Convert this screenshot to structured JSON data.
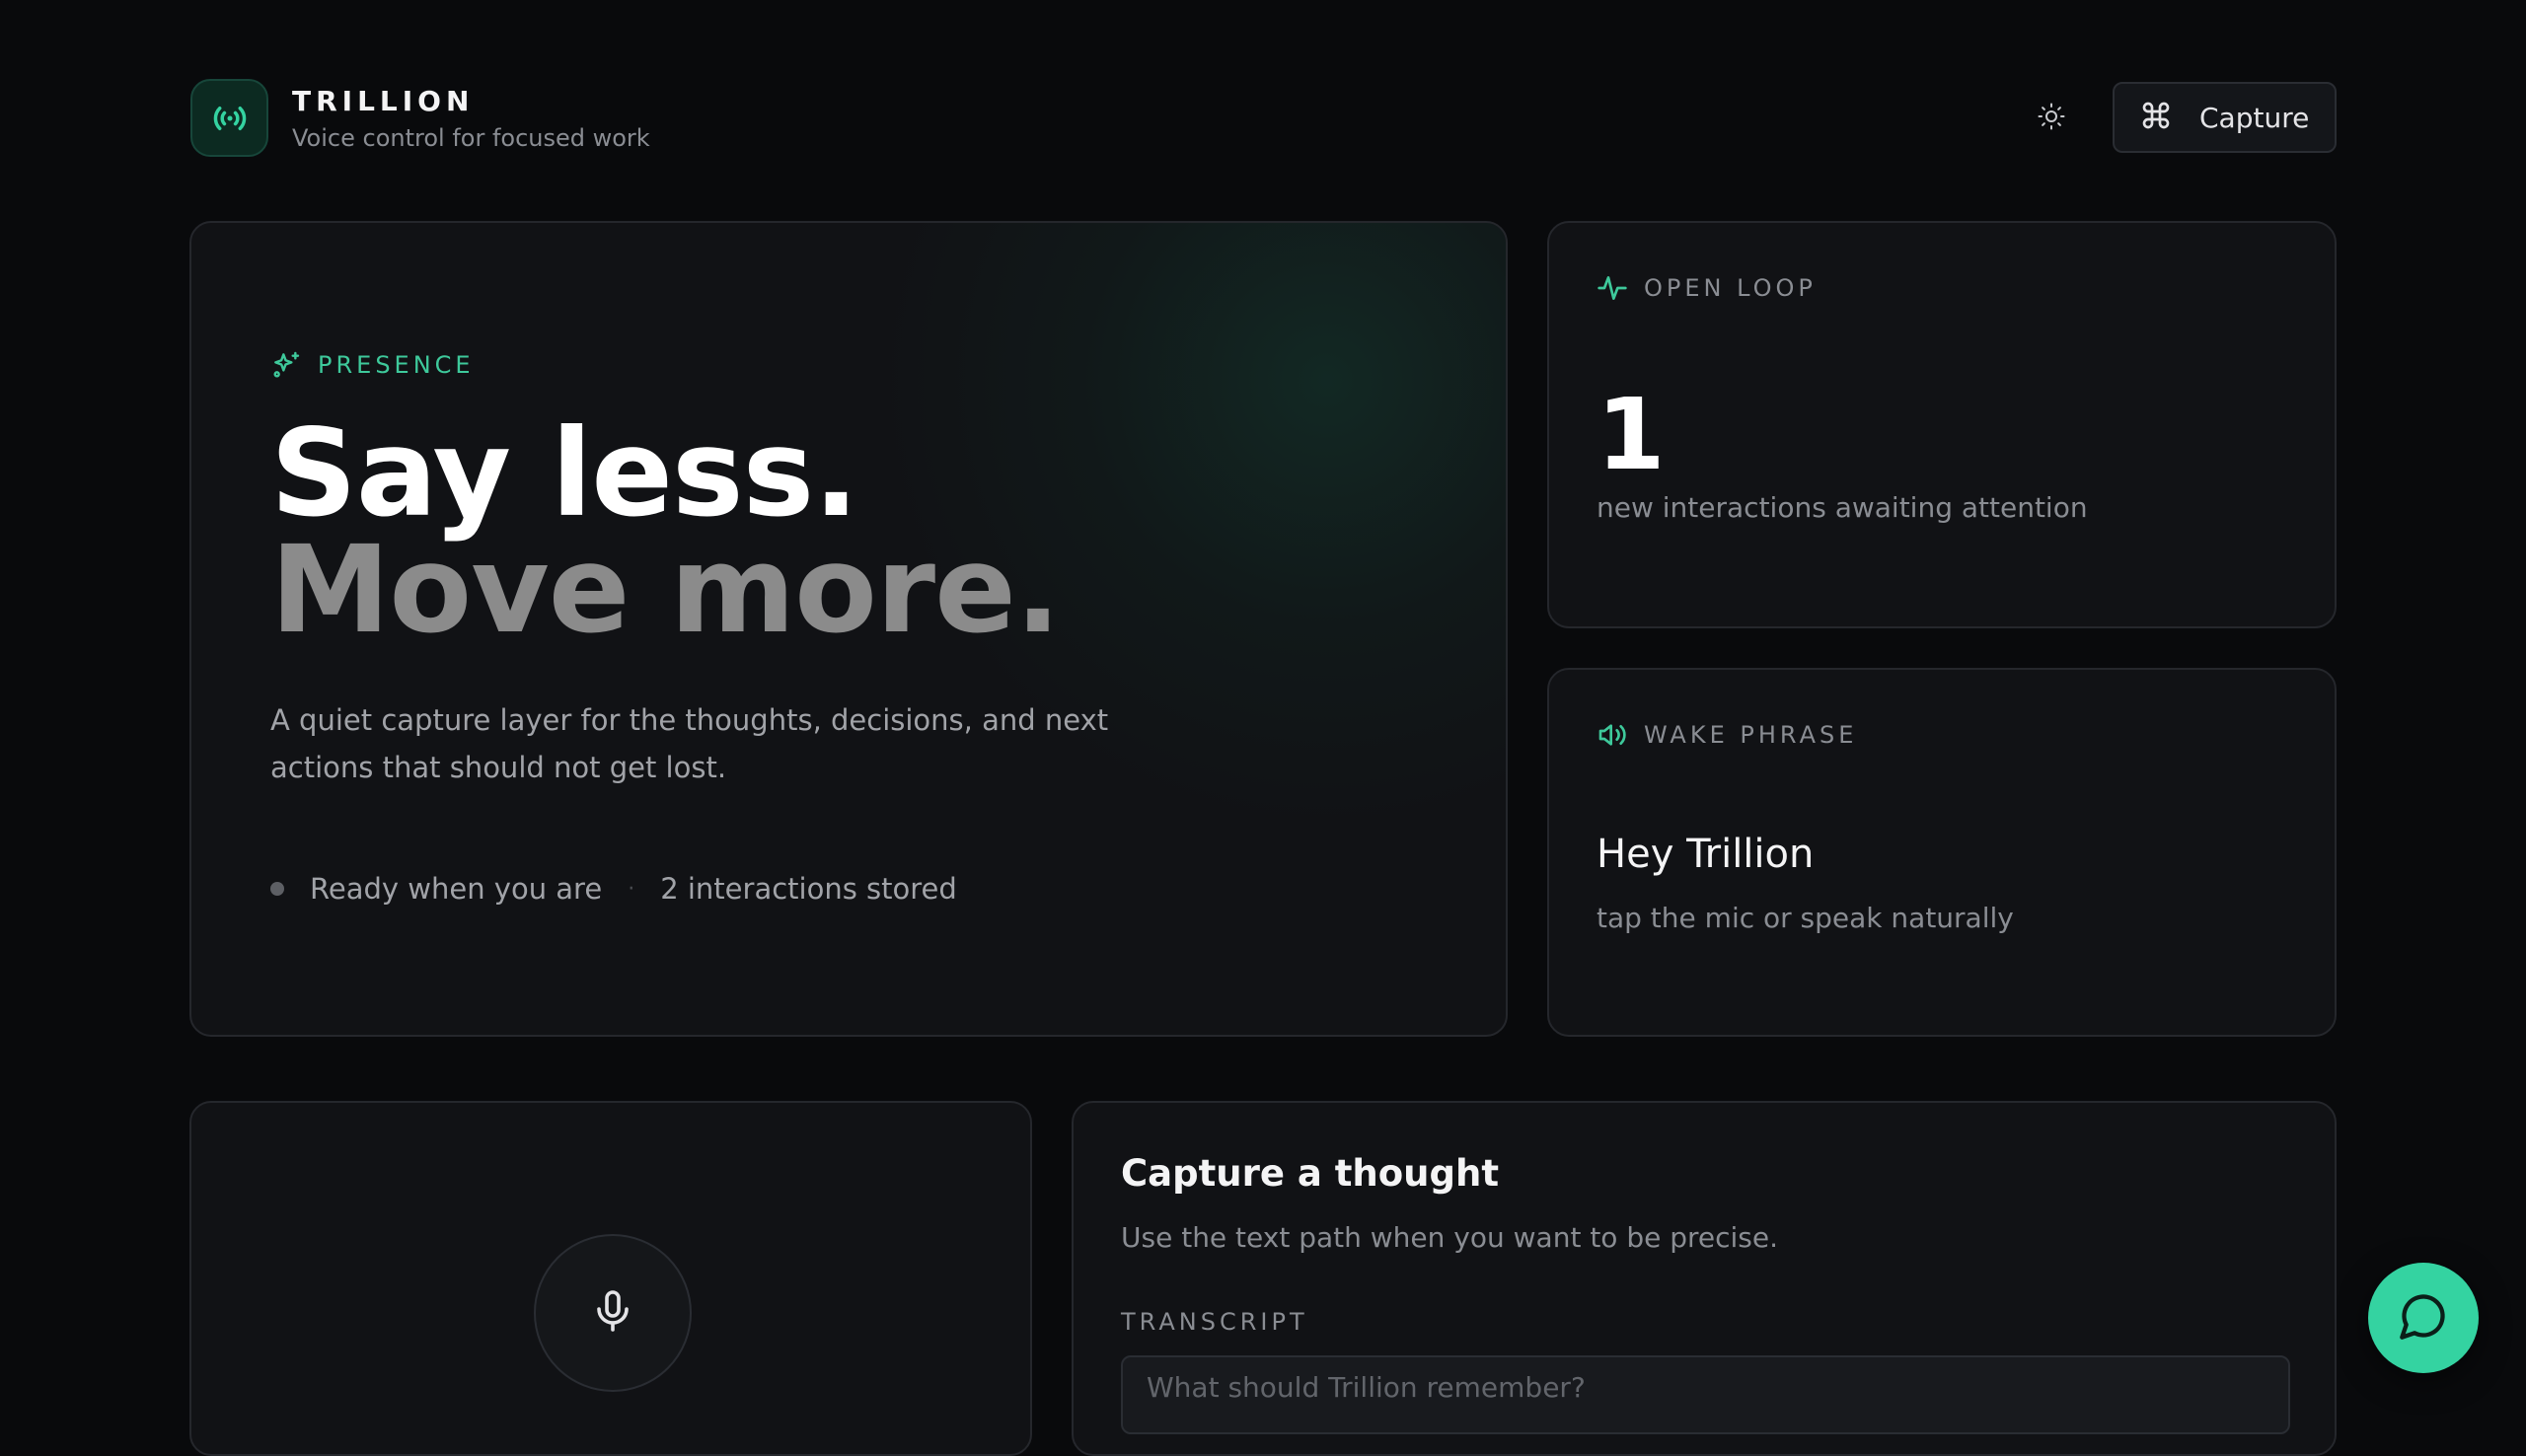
{
  "brand": {
    "name": "TRILLION",
    "tagline": "Voice control for focused work"
  },
  "header": {
    "capture_label": "Capture",
    "theme_icon": "sun-icon",
    "capture_icon": "command-icon"
  },
  "hero": {
    "eyebrow": "PRESENCE",
    "headline_line1": "Say less.",
    "headline_line2": "Move more.",
    "description": "A quiet capture layer for the thoughts, decisions, and next actions that should not get lost.",
    "status_ready": "Ready when you are",
    "status_separator": "·",
    "status_count": "2 interactions stored"
  },
  "open_loop": {
    "eyebrow": "OPEN LOOP",
    "count": "1",
    "subtitle": "new interactions awaiting attention"
  },
  "wake_phrase": {
    "eyebrow": "WAKE PHRASE",
    "phrase": "Hey Trillion",
    "subtitle": "tap the mic or speak naturally"
  },
  "capture": {
    "title": "Capture a thought",
    "description": "Use the text path when you want to be precise.",
    "field_label": "TRANSCRIPT",
    "placeholder": "What should Trillion remember?",
    "value": ""
  },
  "colors": {
    "accent": "#34d3a1",
    "accent_text": "#3ec99b",
    "background": "#090a0c",
    "card": "#111215",
    "border": "#25272c",
    "muted_text": "#8a8d93",
    "headline_secondary": "#8b8b8b"
  }
}
